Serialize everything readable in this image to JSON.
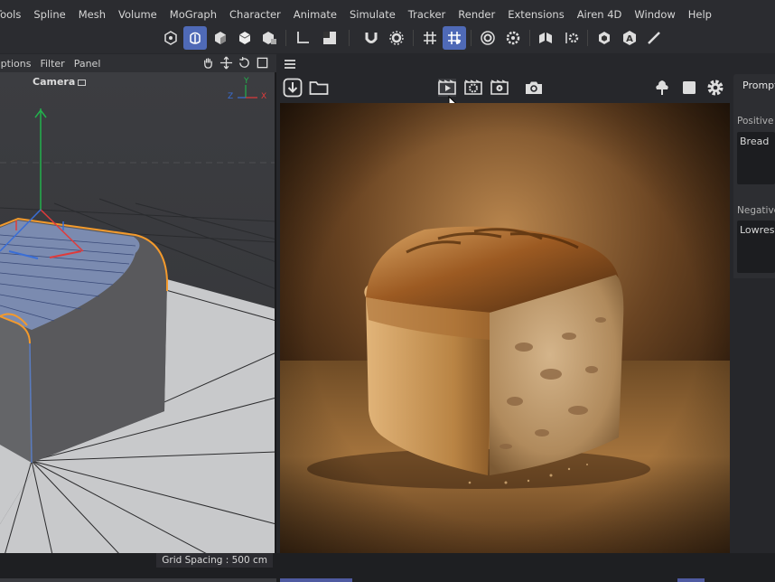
{
  "menu": {
    "items": [
      "Tools",
      "Spline",
      "Mesh",
      "Volume",
      "MoGraph",
      "Character",
      "Animate",
      "Simulate",
      "Tracker",
      "Render",
      "Extensions",
      "Airen 4D",
      "Window",
      "Help"
    ]
  },
  "viewport_menu": {
    "items": [
      "Options",
      "Filter",
      "Panel"
    ]
  },
  "viewport": {
    "camera_label": "Camera",
    "axis_y": "Y",
    "axis_z": "Z",
    "axis_x": "X",
    "grid_spacing": "Grid Spacing : 500 cm"
  },
  "prompt_panel": {
    "tab_label": "Prompt",
    "positive_label": "Positive P",
    "positive_value": "Bread",
    "negative_label": "Negative",
    "negative_value": "Lowres"
  },
  "colors": {
    "accent": "#4f6ab7",
    "orange_select": "#f39a2c",
    "bg": "#26272b"
  },
  "icons": {
    "toolbar": [
      "model-mode-icon",
      "object-mode-icon",
      "point-mode-icon",
      "edge-mode-icon",
      "polygon-mode-icon",
      "axis-icon",
      "texture-mode-icon",
      "magnet-icon",
      "snap-settings-icon",
      "grid-icon",
      "grid-snap-icon",
      "workplane-icon",
      "workplane-settings-icon",
      "symmetry-icon",
      "symmetry-settings-icon",
      "render-view-icon",
      "airen-logo-icon",
      "brush-icon"
    ],
    "render_panel": [
      "menu-icon",
      "download-icon",
      "folder-icon",
      "render-icon",
      "render-region-icon",
      "render-settings-icon",
      "camera-icon",
      "tree-icon",
      "stop-icon",
      "gear-icon"
    ]
  }
}
